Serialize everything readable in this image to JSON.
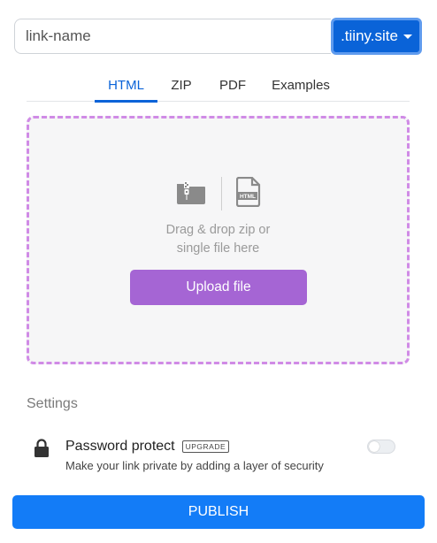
{
  "link": {
    "placeholder": "link-name",
    "domain_label": ".tiiny.site"
  },
  "tabs": [
    {
      "label": "HTML",
      "active": true
    },
    {
      "label": "ZIP",
      "active": false
    },
    {
      "label": "PDF",
      "active": false
    },
    {
      "label": "Examples",
      "active": false
    }
  ],
  "dropzone": {
    "line1": "Drag & drop zip or",
    "line2": "single file here",
    "upload_label": "Upload file",
    "icons": [
      "zip-file-icon",
      "html-file-icon"
    ],
    "html_icon_text": "HTML"
  },
  "settings": {
    "title": "Settings",
    "password": {
      "title": "Password protect",
      "badge": "UPGRADE",
      "description": "Make your link private by adding a layer of security",
      "enabled": false
    }
  },
  "publish_label": "PUBLISH",
  "colors": {
    "primary_blue": "#0a63d8",
    "publish_blue": "#137cf7",
    "purple": "#a565d4",
    "dropzone_border": "#d08be6"
  }
}
